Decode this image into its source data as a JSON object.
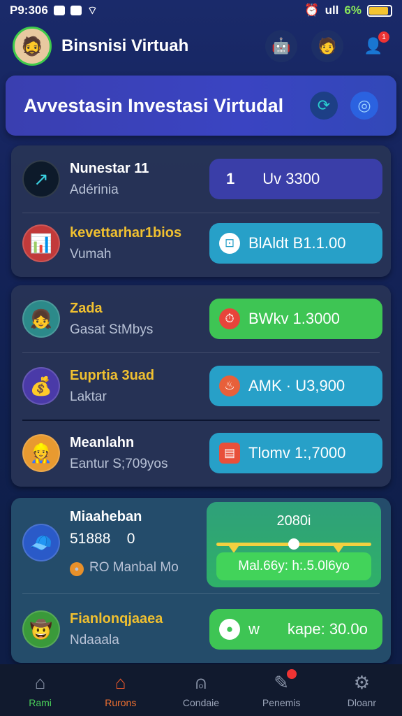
{
  "status_bar": {
    "time": "P9:306",
    "battery_pct": "6%",
    "signal_text": "ull"
  },
  "header": {
    "title": "Binsnisi Virtuah",
    "badge_count": "1"
  },
  "banner": {
    "title": "Avvestasin Investasi Virtudal"
  },
  "investments": [
    {
      "name": "Nunestar 11",
      "sub": "Adérinia",
      "pill_num": "1",
      "pill_text": "Uv 3300",
      "color": "#3a3ea8"
    },
    {
      "name": "kevettarhar1bios",
      "sub": "Vumah",
      "pill_text": "BlAldt B1.1.00",
      "color": "#27a0c8"
    },
    {
      "name": "Zada",
      "sub": "Gasat StMbys",
      "pill_text": "BWkv 1.3000",
      "color": "#3ec554"
    },
    {
      "name": "Euprtia 3uad",
      "sub": "Laktar",
      "pill_text": "AMK · U3,900",
      "color": "#27a0c8"
    },
    {
      "name": "Meanlahn",
      "sub": "Eantur S;709yos",
      "pill_text": "Tlomv 1:,7000",
      "color": "#27a0c8"
    },
    {
      "name": "Miaaheban",
      "sub": "51888",
      "sub_value": "0",
      "extra": "RO  Manbal Mo"
    },
    {
      "name": "Fianlonqjaaea",
      "sub": "Ndaaala",
      "pill_text": "kape: 30.0o",
      "pill_prefix": "w",
      "color": "#3ec554"
    }
  ],
  "slider": {
    "value_label": "2080i",
    "level": 0.5,
    "pill_text": "Mal.66y: h:.5.0l6yo"
  },
  "bottom_nav": [
    {
      "label": "Rami",
      "icon": "home-icon"
    },
    {
      "label": "Rurons",
      "icon": "home-active-icon"
    },
    {
      "label": "Condaie",
      "icon": "bell-icon"
    },
    {
      "label": "Penemis",
      "icon": "chat-icon"
    },
    {
      "label": "Dloanr",
      "icon": "gear-icon"
    }
  ]
}
